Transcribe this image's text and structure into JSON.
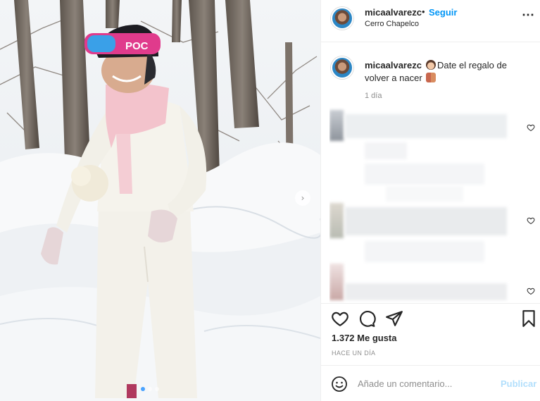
{
  "post": {
    "username": "micaalvarezc",
    "follow_separator": "•",
    "follow_label": "Seguir",
    "location": "Cerro Chapelco",
    "more_icon": "⋯",
    "caption_text": "Date el regalo de volver a nacer",
    "caption_time": "1 día",
    "likes": "1.372 Me gusta",
    "posted_ago": "HACE UN DÍA",
    "comment_placeholder": "Añade un comentario...",
    "publish_label": "Publicar"
  },
  "photo": {
    "next_arrow": "›",
    "slide_count": 3,
    "active_slide": 1
  },
  "icons": {
    "header": [
      "more-options-icon"
    ],
    "actions": [
      "heart-icon",
      "comment-icon",
      "share-icon",
      "bookmark-icon"
    ],
    "comment_bar": [
      "emoji-icon"
    ],
    "comments": [
      "comment-like-icon"
    ]
  },
  "colors": {
    "accent": "#0095f6",
    "publish_disabled": "#b2dffc",
    "text_primary": "#262626",
    "text_secondary": "#8e8e8e",
    "divider": "#efefef"
  }
}
